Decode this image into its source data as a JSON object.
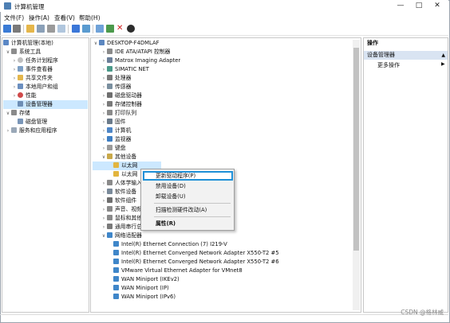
{
  "window": {
    "title": "计算机管理",
    "controls": {
      "minimize": "—",
      "maximize": "□",
      "close": "✕"
    }
  },
  "menu": {
    "items": [
      {
        "label": "文件(F)"
      },
      {
        "label": "操作(A)"
      },
      {
        "label": "查看(V)"
      },
      {
        "label": "帮助(H)"
      }
    ]
  },
  "left_tree": {
    "items": [
      {
        "label": "计算机管理(本地)",
        "level": 0,
        "expanded": true
      },
      {
        "label": "系统工具",
        "level": 1,
        "expanded": true
      },
      {
        "label": "任务计划程序",
        "level": 2
      },
      {
        "label": "事件查看器",
        "level": 2
      },
      {
        "label": "共享文件夹",
        "level": 2
      },
      {
        "label": "本地用户和组",
        "level": 2
      },
      {
        "label": "性能",
        "level": 2
      },
      {
        "label": "设备管理器",
        "level": 2,
        "selected": true
      },
      {
        "label": "存储",
        "level": 1,
        "expanded": true
      },
      {
        "label": "磁盘管理",
        "level": 2
      },
      {
        "label": "服务和应用程序",
        "level": 1
      }
    ]
  },
  "device_tree": {
    "root": "DESKTOP-F4DMLAF",
    "items": [
      {
        "label": "IDE ATA/ATAPI 控制器"
      },
      {
        "label": "Matrox Imaging Adapter"
      },
      {
        "label": "SIMATIC NET"
      },
      {
        "label": "处理器"
      },
      {
        "label": "传感器"
      },
      {
        "label": "磁盘驱动器"
      },
      {
        "label": "存储控制器"
      },
      {
        "label": "打印队列"
      },
      {
        "label": "固件"
      },
      {
        "label": "计算机"
      },
      {
        "label": "监视器"
      },
      {
        "label": "键盘"
      },
      {
        "label": "其他设备",
        "expanded": true
      },
      {
        "label": "以太网",
        "child": true,
        "selected": true
      },
      {
        "label": "以太网",
        "child": true
      },
      {
        "label": "人体学输入设备"
      },
      {
        "label": "软件设备"
      },
      {
        "label": "软件组件"
      },
      {
        "label": "声音、视频和游戏控制器"
      },
      {
        "label": "鼠标和其他指针设备"
      },
      {
        "label": "通用串行总线控制器"
      },
      {
        "label": "网络适配器",
        "expanded": true
      },
      {
        "label": "Intel(R) Ethernet Connection (7) I219-V",
        "child": true
      },
      {
        "label": "Intel(R) Ethernet Converged Network Adapter X550-T2 #5",
        "child": true
      },
      {
        "label": "Intel(R) Ethernet Converged Network Adapter X550-T2 #6",
        "child": true
      },
      {
        "label": "VMware Virtual Ethernet Adapter for VMnet8",
        "child": true
      },
      {
        "label": "WAN Miniport (IKEv2)",
        "child": true
      },
      {
        "label": "WAN Miniport (IP)",
        "child": true
      },
      {
        "label": "WAN Miniport (IPv6)",
        "child": true
      }
    ]
  },
  "context_menu": {
    "items": [
      {
        "label": "更新驱动程序(P)",
        "highlighted": true
      },
      {
        "label": "禁用设备(D)"
      },
      {
        "label": "卸载设备(U)"
      },
      {
        "label": "扫描检测硬件改动(A)"
      },
      {
        "label": "属性(R)",
        "bold": true
      }
    ]
  },
  "actions": {
    "header": "操作",
    "section": "设备管理器",
    "more": "更多操作"
  },
  "watermark": "CSDN @格林威",
  "colors": {
    "selection": "#cce8ff",
    "highlight_border": "#1e90d8",
    "actions_bar": "#d9e4f2"
  }
}
